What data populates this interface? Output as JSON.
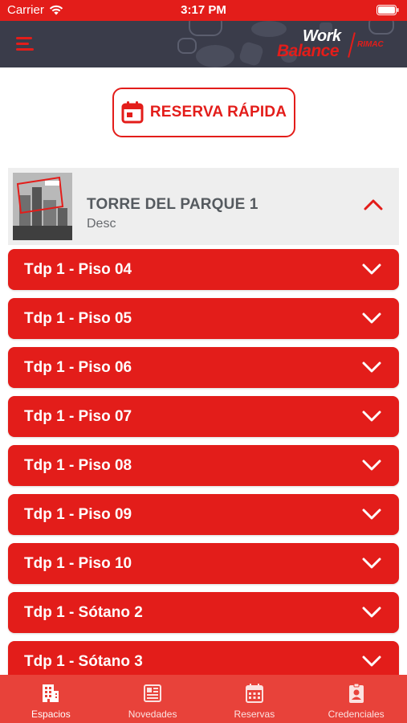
{
  "status": {
    "carrier": "Carrier",
    "time": "3:17 PM"
  },
  "header": {
    "logo_work": "Work",
    "logo_balance": "Balance",
    "logo_rimac": "RIMAC",
    "icons": [
      "menu-icon"
    ]
  },
  "quick_reserve": {
    "label": "RESERVA RÁPIDA",
    "icon": "calendar-icon"
  },
  "building": {
    "name": "TORRE DEL PARQUE 1",
    "description": "Desc",
    "expanded": true
  },
  "floors": [
    {
      "label": "Tdp 1 - Piso 04"
    },
    {
      "label": "Tdp 1 - Piso 05"
    },
    {
      "label": "Tdp 1 - Piso 06"
    },
    {
      "label": "Tdp 1 - Piso 07"
    },
    {
      "label": "Tdp 1 - Piso 08"
    },
    {
      "label": "Tdp 1 - Piso 09"
    },
    {
      "label": "Tdp 1 - Piso 10"
    },
    {
      "label": "Tdp 1 - Sótano 2"
    },
    {
      "label": "Tdp 1 - Sótano 3"
    }
  ],
  "tabs": [
    {
      "label": "Espacios",
      "icon": "building-icon",
      "active": true
    },
    {
      "label": "Novedades",
      "icon": "newspaper-icon",
      "active": false
    },
    {
      "label": "Reservas",
      "icon": "calendar-grid-icon",
      "active": false
    },
    {
      "label": "Credenciales",
      "icon": "badge-icon",
      "active": false
    }
  ],
  "colors": {
    "brand_red": "#e31d1a",
    "header_dark": "#3a3c4a",
    "tabbar": "#e8423a"
  }
}
